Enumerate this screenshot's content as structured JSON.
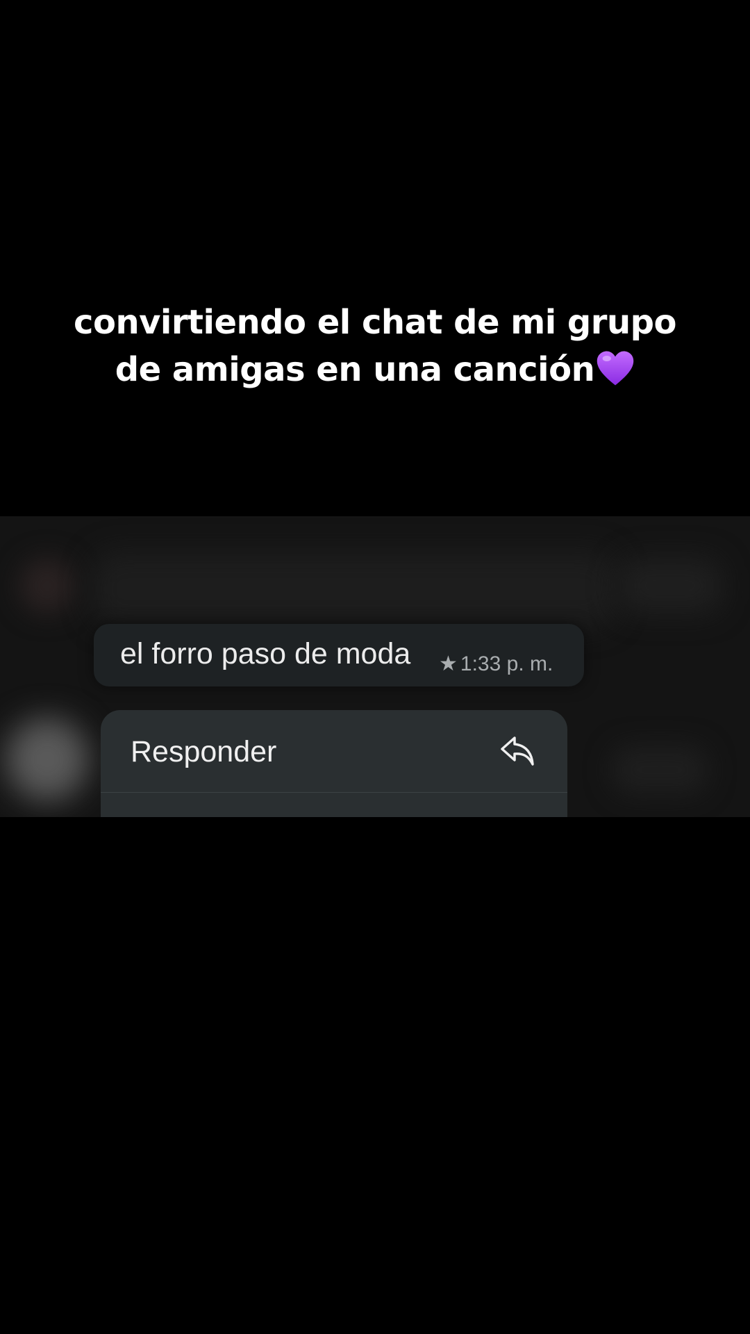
{
  "overlay": {
    "caption_line1": "convirtiendo el chat de mi grupo",
    "caption_line2": "de amigas en una canción",
    "caption_emoji": "purple-heart-icon",
    "caption_color": "#ffffff"
  },
  "chat": {
    "message": {
      "text": "el forro paso de moda",
      "starred": true,
      "time": "1:33 p. m."
    },
    "context_menu": {
      "items": [
        {
          "label": "Responder",
          "icon": "reply-icon"
        }
      ]
    }
  },
  "colors": {
    "background": "#000000",
    "bubble": "#1e2224",
    "menu": "#2a2f31",
    "meta_text": "#a9adaf",
    "heart": "#a83ff0"
  }
}
